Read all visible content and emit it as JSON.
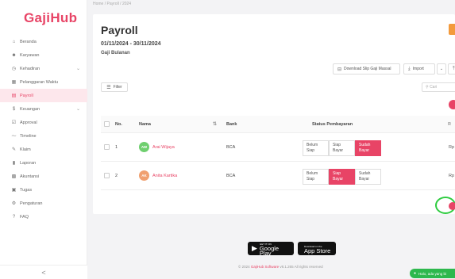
{
  "app": {
    "logo": "GajiHub",
    "breadcrumb": "Home / Payroll / 2024"
  },
  "colors": {
    "brand": "#e84466",
    "accent_orange": "#f39a3c",
    "chat_green": "#2db84d"
  },
  "sidebar": {
    "items": [
      {
        "label": "Beranda",
        "icon": "home-icon"
      },
      {
        "label": "Karyawan",
        "icon": "user-icon"
      },
      {
        "label": "Kehadiran",
        "icon": "clock-icon",
        "expandable": true
      },
      {
        "label": "Pelanggaran Waktu",
        "icon": "calendar-icon"
      },
      {
        "label": "Payroll",
        "icon": "payroll-icon",
        "active": true
      },
      {
        "label": "Keuangan",
        "icon": "dollar-icon",
        "expandable": true
      },
      {
        "label": "Approval",
        "icon": "check-icon"
      },
      {
        "label": "Timeline",
        "icon": "timeline-icon"
      },
      {
        "label": "Klaim",
        "icon": "claim-icon"
      },
      {
        "label": "Laporan",
        "icon": "report-icon"
      },
      {
        "label": "Akuntansi",
        "icon": "accounting-icon"
      },
      {
        "label": "Tugas",
        "icon": "task-icon"
      },
      {
        "label": "Pengaturan",
        "icon": "gear-icon"
      },
      {
        "label": "FAQ",
        "icon": "question-icon"
      }
    ],
    "collapse_label": "<"
  },
  "main": {
    "title": "Payroll",
    "period": "01/11/2024 - 30/11/2024",
    "pay_type": "Gaji Bulanan",
    "toolbar": {
      "download_label": "Download Slip Gaji Massal",
      "import_label": "Import",
      "more_label": "⌄",
      "last_label": "E"
    },
    "filter_label": "Filter",
    "search_placeholder": "Cari"
  },
  "table": {
    "headers": {
      "no": "No.",
      "nama": "Nama",
      "bank": "Bank",
      "status": "Status Pembayaran",
      "rp": "R"
    },
    "rows": [
      {
        "no": "1",
        "initials": "AW",
        "avatar_color": "#6fcf6f",
        "name": "Arai Wijaya",
        "bank": "BCA",
        "status_options": [
          "Belum Siap",
          "Siap Bayar",
          "Sudah Bayar"
        ],
        "active_status": 2,
        "rp": "Rp"
      },
      {
        "no": "2",
        "initials": "AK",
        "avatar_color": "#f0a070",
        "name": "Anita Kartika",
        "bank": "BCA",
        "status_options": [
          "Belum Siap",
          "Siap Bayar",
          "Sudah Bayar"
        ],
        "active_status": 1,
        "rp": "Rp"
      }
    ]
  },
  "footer": {
    "google_play_small": "GET IT ON",
    "google_play": "Google Play",
    "app_store_small": "Download on the",
    "app_store": "App Store",
    "copyright_prefix": "© 2024",
    "copyright_brand": "GajiHub Software",
    "copyright_suffix": "v8.1.265 All rights reserved"
  },
  "chat": {
    "label": "Halo, ada yang bi"
  }
}
